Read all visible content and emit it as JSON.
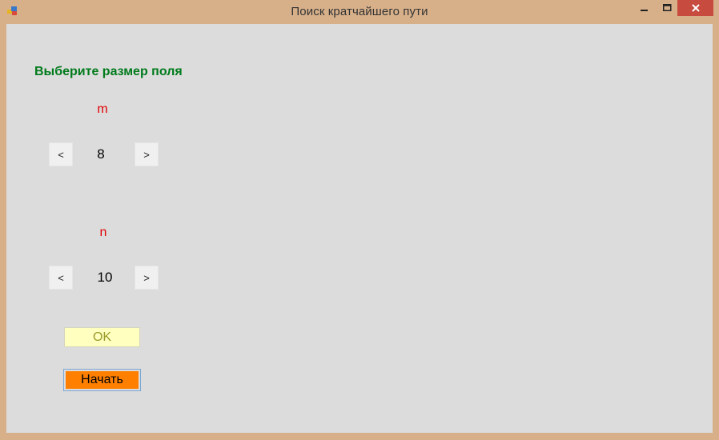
{
  "window": {
    "title": "Поиск кратчайшего пути",
    "minimize_icon": "minimize-icon",
    "maximize_icon": "maximize-icon",
    "close_icon": "close-icon"
  },
  "form": {
    "heading": "Выберите размер поля",
    "m": {
      "label": "m",
      "decrement": "<",
      "value": "8",
      "increment": ">"
    },
    "n": {
      "label": "n",
      "decrement": "<",
      "value": "10",
      "increment": ">"
    },
    "ok_label": "OK",
    "start_label": "Начать"
  },
  "colors": {
    "heading": "#007a1b",
    "axis_label": "#e00000",
    "ok_bg": "#ffffc0",
    "start_bg": "#ff8000",
    "close_bg": "#c74b3f"
  }
}
